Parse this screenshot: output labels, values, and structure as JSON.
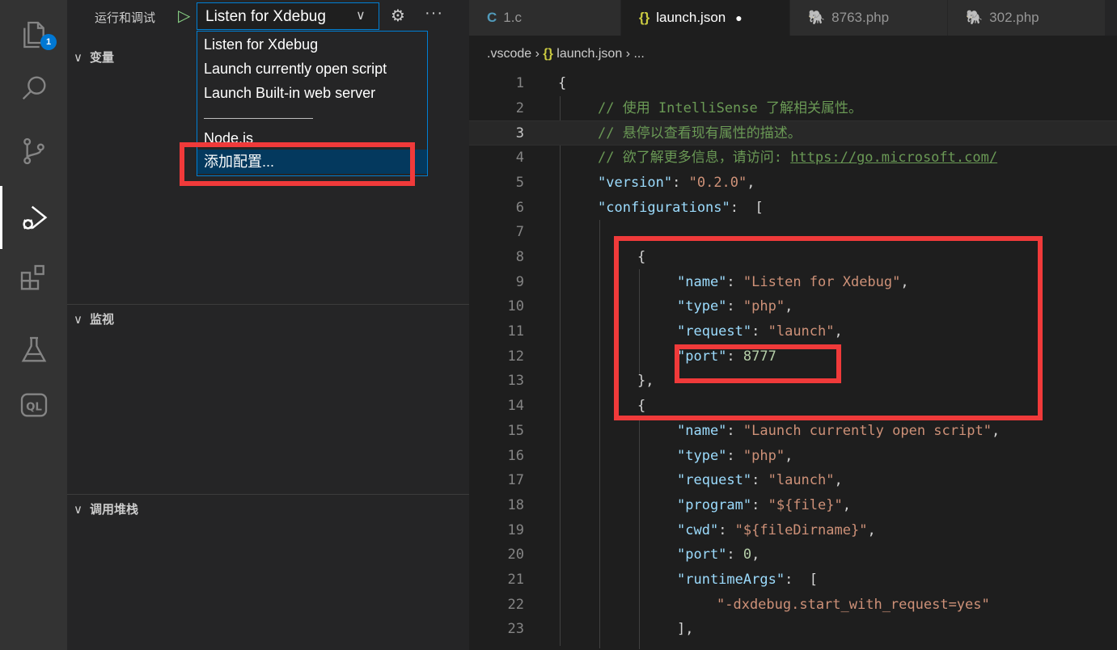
{
  "activity_bar": {
    "explorer_badge": "1",
    "items": [
      {
        "name": "explorer-icon"
      },
      {
        "name": "search-icon"
      },
      {
        "name": "source-control-icon"
      },
      {
        "name": "run-debug-icon"
      },
      {
        "name": "extensions-icon"
      },
      {
        "name": "testing-icon"
      },
      {
        "name": "codeql-icon",
        "label": "QL"
      }
    ]
  },
  "sidebar": {
    "title": "运行和调试",
    "run_glyph": "▷",
    "config_selected": "Listen for Xdebug",
    "chevron": "∨",
    "gear_glyph": "⚙",
    "more_glyph": "···",
    "sections": {
      "variables": "变量",
      "watch": "监视",
      "call_stack": "调用堆栈"
    },
    "twistie": "∨",
    "dropdown": {
      "items": [
        "Listen for Xdebug",
        "Launch currently open script",
        "Launch Built-in web server"
      ],
      "partial_item": "Node.js",
      "selected_item": "添加配置..."
    }
  },
  "editor": {
    "tabs": [
      {
        "icon": "C",
        "label": "1.c"
      },
      {
        "icon": "{}",
        "label": "launch.json",
        "modified_dot": "●"
      },
      {
        "icon": "🐘",
        "label": "8763.php"
      },
      {
        "icon": "🐘",
        "label": "302.php"
      }
    ],
    "breadcrumb": {
      "folder": ".vscode",
      "sep": "›",
      "file_icon": "{}",
      "file": "launch.json",
      "tail": "..."
    },
    "current_line": 3,
    "lines": [
      {
        "n": "1",
        "t": "{"
      },
      {
        "n": "2",
        "t": "// 使用 IntelliSense 了解相关属性。"
      },
      {
        "n": "3",
        "t": "// 悬停以查看现有属性的描述。"
      },
      {
        "n": "4",
        "t": "// 欲了解更多信息，请访问: ",
        "url": "https://go.microsoft.com/"
      },
      {
        "n": "5",
        "k": "\"version\"",
        "v": "\"0.2.0\"",
        "tail": ","
      },
      {
        "n": "6",
        "k": "\"configurations\"",
        "tail": " ["
      },
      {
        "n": "7",
        "t": ""
      },
      {
        "n": "8",
        "t": "{"
      },
      {
        "n": "9",
        "k": "\"name\"",
        "v": "\"Listen for Xdebug\"",
        "tail": ","
      },
      {
        "n": "10",
        "k": "\"type\"",
        "v": "\"php\"",
        "tail": ","
      },
      {
        "n": "11",
        "k": "\"request\"",
        "v": "\"launch\"",
        "tail": ","
      },
      {
        "n": "12",
        "k": "\"port\"",
        "num": "8777"
      },
      {
        "n": "13",
        "t": "},"
      },
      {
        "n": "14",
        "t": "{"
      },
      {
        "n": "15",
        "k": "\"name\"",
        "v": "\"Launch currently open script\"",
        "tail": ","
      },
      {
        "n": "16",
        "k": "\"type\"",
        "v": "\"php\"",
        "tail": ","
      },
      {
        "n": "17",
        "k": "\"request\"",
        "v": "\"launch\"",
        "tail": ","
      },
      {
        "n": "18",
        "k": "\"program\"",
        "v": "\"${file}\"",
        "tail": ","
      },
      {
        "n": "19",
        "k": "\"cwd\"",
        "v": "\"${fileDirname}\"",
        "tail": ","
      },
      {
        "n": "20",
        "k": "\"port\"",
        "num": "0",
        "tail": ","
      },
      {
        "n": "21",
        "k": "\"runtimeArgs\"",
        "tail": " ["
      },
      {
        "n": "22",
        "v": "\"-dxdebug.start_with_request=yes\""
      },
      {
        "n": "23",
        "t": "],"
      }
    ]
  }
}
